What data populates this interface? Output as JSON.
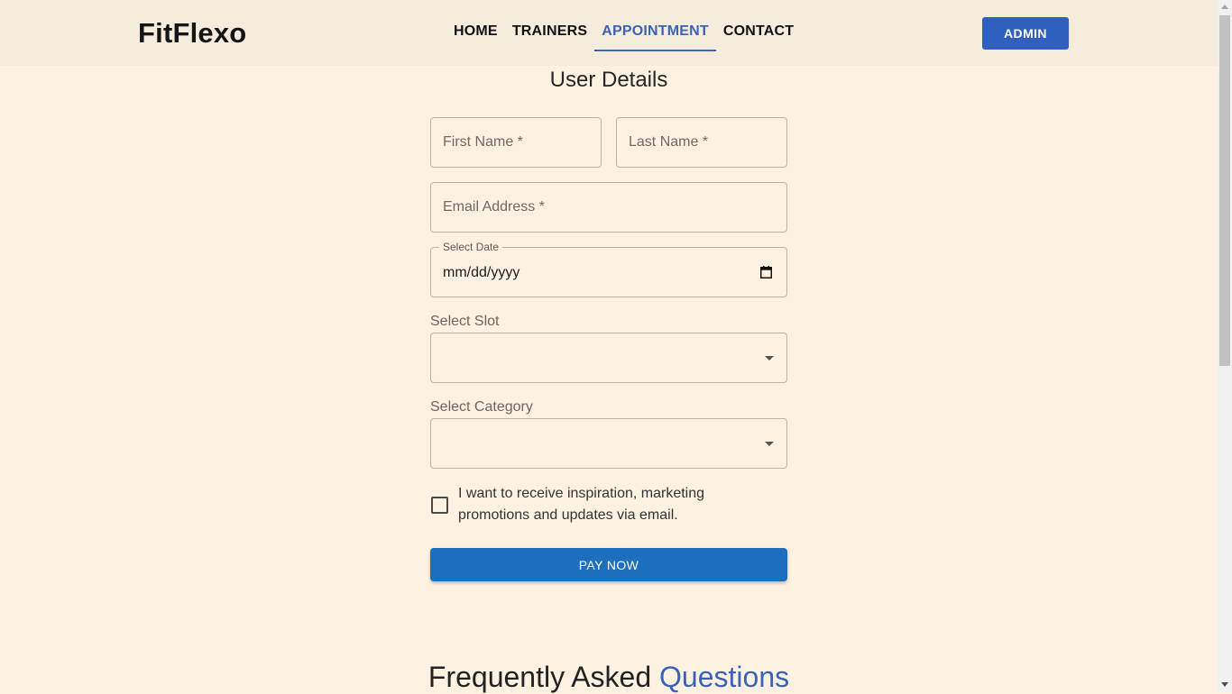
{
  "brand": "FitFlexo",
  "nav": {
    "items": [
      "HOME",
      "TRAINERS",
      "APPOINTMENT",
      "CONTACT"
    ],
    "active": "APPOINTMENT",
    "admin_label": "ADMIN"
  },
  "form": {
    "title": "User Details",
    "first_name_placeholder": "First Name *",
    "last_name_placeholder": "Last Name *",
    "email_placeholder": "Email Address *",
    "date_label": "Select Date",
    "date_value": "mm/dd/yyyy",
    "slot_label": "Select Slot",
    "slot_value": "",
    "category_label": "Select Category",
    "category_value": "",
    "marketing_checkbox_label": "I want to receive inspiration, marketing promotions and updates via email.",
    "marketing_checked": false,
    "pay_label": "PAY NOW"
  },
  "faq": {
    "title_part1": "Frequently Asked",
    "title_part2": "Questions"
  },
  "colors": {
    "accent": "#3a63b7",
    "pay_button": "#1d6fbd",
    "page_background": "#fdf2e2",
    "navbar_background": "#f6ecdd"
  },
  "icons": [
    "calendar-icon",
    "dropdown-caret-icon",
    "checkbox-icon"
  ]
}
